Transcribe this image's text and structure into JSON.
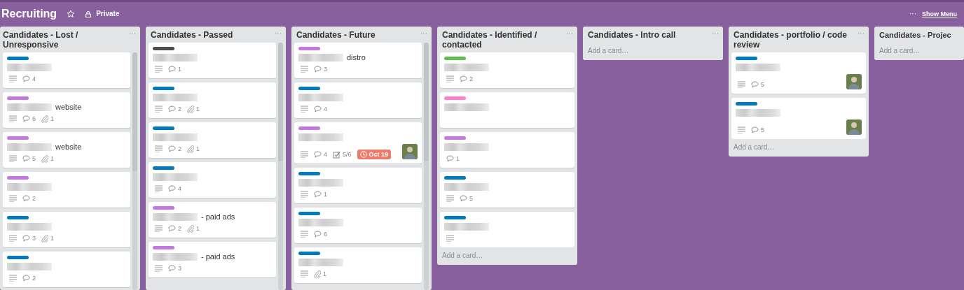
{
  "board": {
    "title": "Recruiting",
    "starred": false,
    "visibility": "Private",
    "more": "···",
    "show_menu": "Show Menu"
  },
  "lists": [
    {
      "title": "Candidates - Lost / Unresponsive",
      "menu": "···",
      "scrollbar": true,
      "cards": [
        {
          "color": "#0079bf",
          "redacted": true,
          "description": true,
          "comments": "4"
        },
        {
          "color": "#c377e0",
          "redacted": true,
          "title": "website",
          "description": true,
          "comments": "6",
          "attachments": "1"
        },
        {
          "color": "#c377e0",
          "redacted": true,
          "title": "website",
          "description": true,
          "comments": "5",
          "attachments": "1"
        },
        {
          "color": "#c377e0",
          "redacted": true,
          "description": true,
          "comments": "2"
        },
        {
          "color": "#0079bf",
          "redacted": true,
          "description": true,
          "comments": "3",
          "attachments": "1"
        },
        {
          "color": "#0079bf",
          "redacted": true,
          "description": true,
          "comments": "2"
        }
      ]
    },
    {
      "title": "Candidates - Passed",
      "menu": "···",
      "scrollbar": true,
      "cards": [
        {
          "color": "#4d4d4d",
          "redacted": true,
          "description": true,
          "comments": "1"
        },
        {
          "color": "#0079bf",
          "redacted": true,
          "description": true,
          "comments": "2",
          "attachments": "1"
        },
        {
          "color": "#0079bf",
          "redacted": true,
          "description": true,
          "comments": "2",
          "attachments": "1"
        },
        {
          "color": "#0079bf",
          "redacted": true,
          "description": true,
          "comments": "4"
        },
        {
          "color": "#c377e0",
          "redacted": true,
          "title": "- paid ads",
          "description": true,
          "comments": "2",
          "attachments": "1"
        },
        {
          "color": "#c377e0",
          "redacted": true,
          "title": "- paid ads",
          "description": true,
          "comments": "3"
        }
      ]
    },
    {
      "title": "Candidates - Future",
      "menu": "···",
      "scrollbar": true,
      "cards": [
        {
          "color": "#c377e0",
          "redacted": true,
          "title": "distro",
          "description": true,
          "comments": "3"
        },
        {
          "color": "#0079bf",
          "redacted": true,
          "description": true,
          "comments": "4"
        },
        {
          "color": "#c377e0",
          "redacted": true,
          "description": true,
          "comments": "4",
          "checklist": "5/6",
          "due": "Oct 19",
          "avatar": true
        },
        {
          "color": "#0079bf",
          "redacted": true,
          "description": true,
          "comments": "1"
        },
        {
          "color": "#0079bf",
          "redacted": true,
          "description": true,
          "comments": "6"
        },
        {
          "color": "#0079bf",
          "redacted": true,
          "description": true,
          "attachments": "1"
        }
      ]
    },
    {
      "title": "Candidates - Identified / contacted",
      "menu": "···",
      "scrollbar": false,
      "add_card": "Add a card…",
      "cards": [
        {
          "color": "#61bd4f",
          "redacted": true,
          "description": true,
          "comments": "2"
        },
        {
          "color": "#ff80ce",
          "redacted": true,
          "description": false
        },
        {
          "color": "#c377e0",
          "redacted": true,
          "description": false,
          "comments": "1"
        },
        {
          "color": "#0079bf",
          "redacted": true,
          "description": true,
          "comments": "5"
        },
        {
          "color": "#0079bf",
          "redacted": true,
          "description": true
        }
      ]
    },
    {
      "title": "Candidates - Intro call",
      "menu": "···",
      "scrollbar": false,
      "add_card": "Add a card…"
    },
    {
      "title": "Candidates - portfolio / code review",
      "menu": "···",
      "scrollbar": false,
      "add_card": "Add a card…",
      "cards": [
        {
          "color": "#0079bf",
          "redacted": true,
          "description": true,
          "comments": "5",
          "avatar": true
        },
        {
          "color": "#0079bf",
          "redacted": true,
          "description": true,
          "comments": "5",
          "avatar": true
        }
      ]
    },
    {
      "title": "Candidates - Projec",
      "scrollbar": false,
      "add_card": "Add a card…"
    }
  ]
}
